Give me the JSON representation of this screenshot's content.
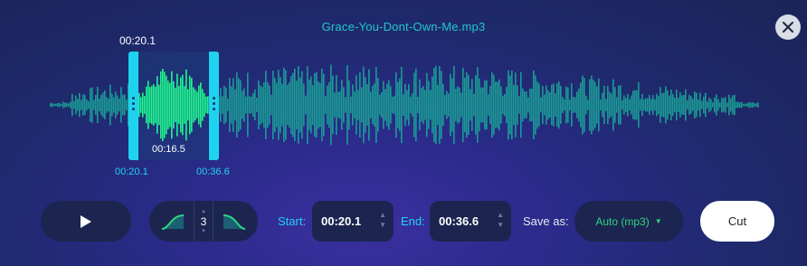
{
  "file": {
    "name": "Grace-You-Dont-Own-Me.mp3"
  },
  "selection": {
    "top_time": "00:20.1",
    "duration": "00:16.5",
    "start_label": "00:20.1",
    "end_label": "00:36.6"
  },
  "controls": {
    "fade_value": "3",
    "start_label": "Start:",
    "start_value": "00:20.1",
    "end_label": "End:",
    "end_value": "00:36.6",
    "save_as_label": "Save as:",
    "format_value": "Auto (mp3)",
    "cut_label": "Cut"
  },
  "icons": {
    "close": "close-icon",
    "play": "play-icon",
    "fade_in": "fade-in-icon",
    "fade_out": "fade-out-icon",
    "dropdown": "chevron-down-icon"
  },
  "colors": {
    "accent": "#1fd3f0",
    "waveform": "#1a9a94",
    "waveform_selected": "#1ef58f",
    "format_text": "#2fd47f",
    "panel": "#1c2550"
  }
}
